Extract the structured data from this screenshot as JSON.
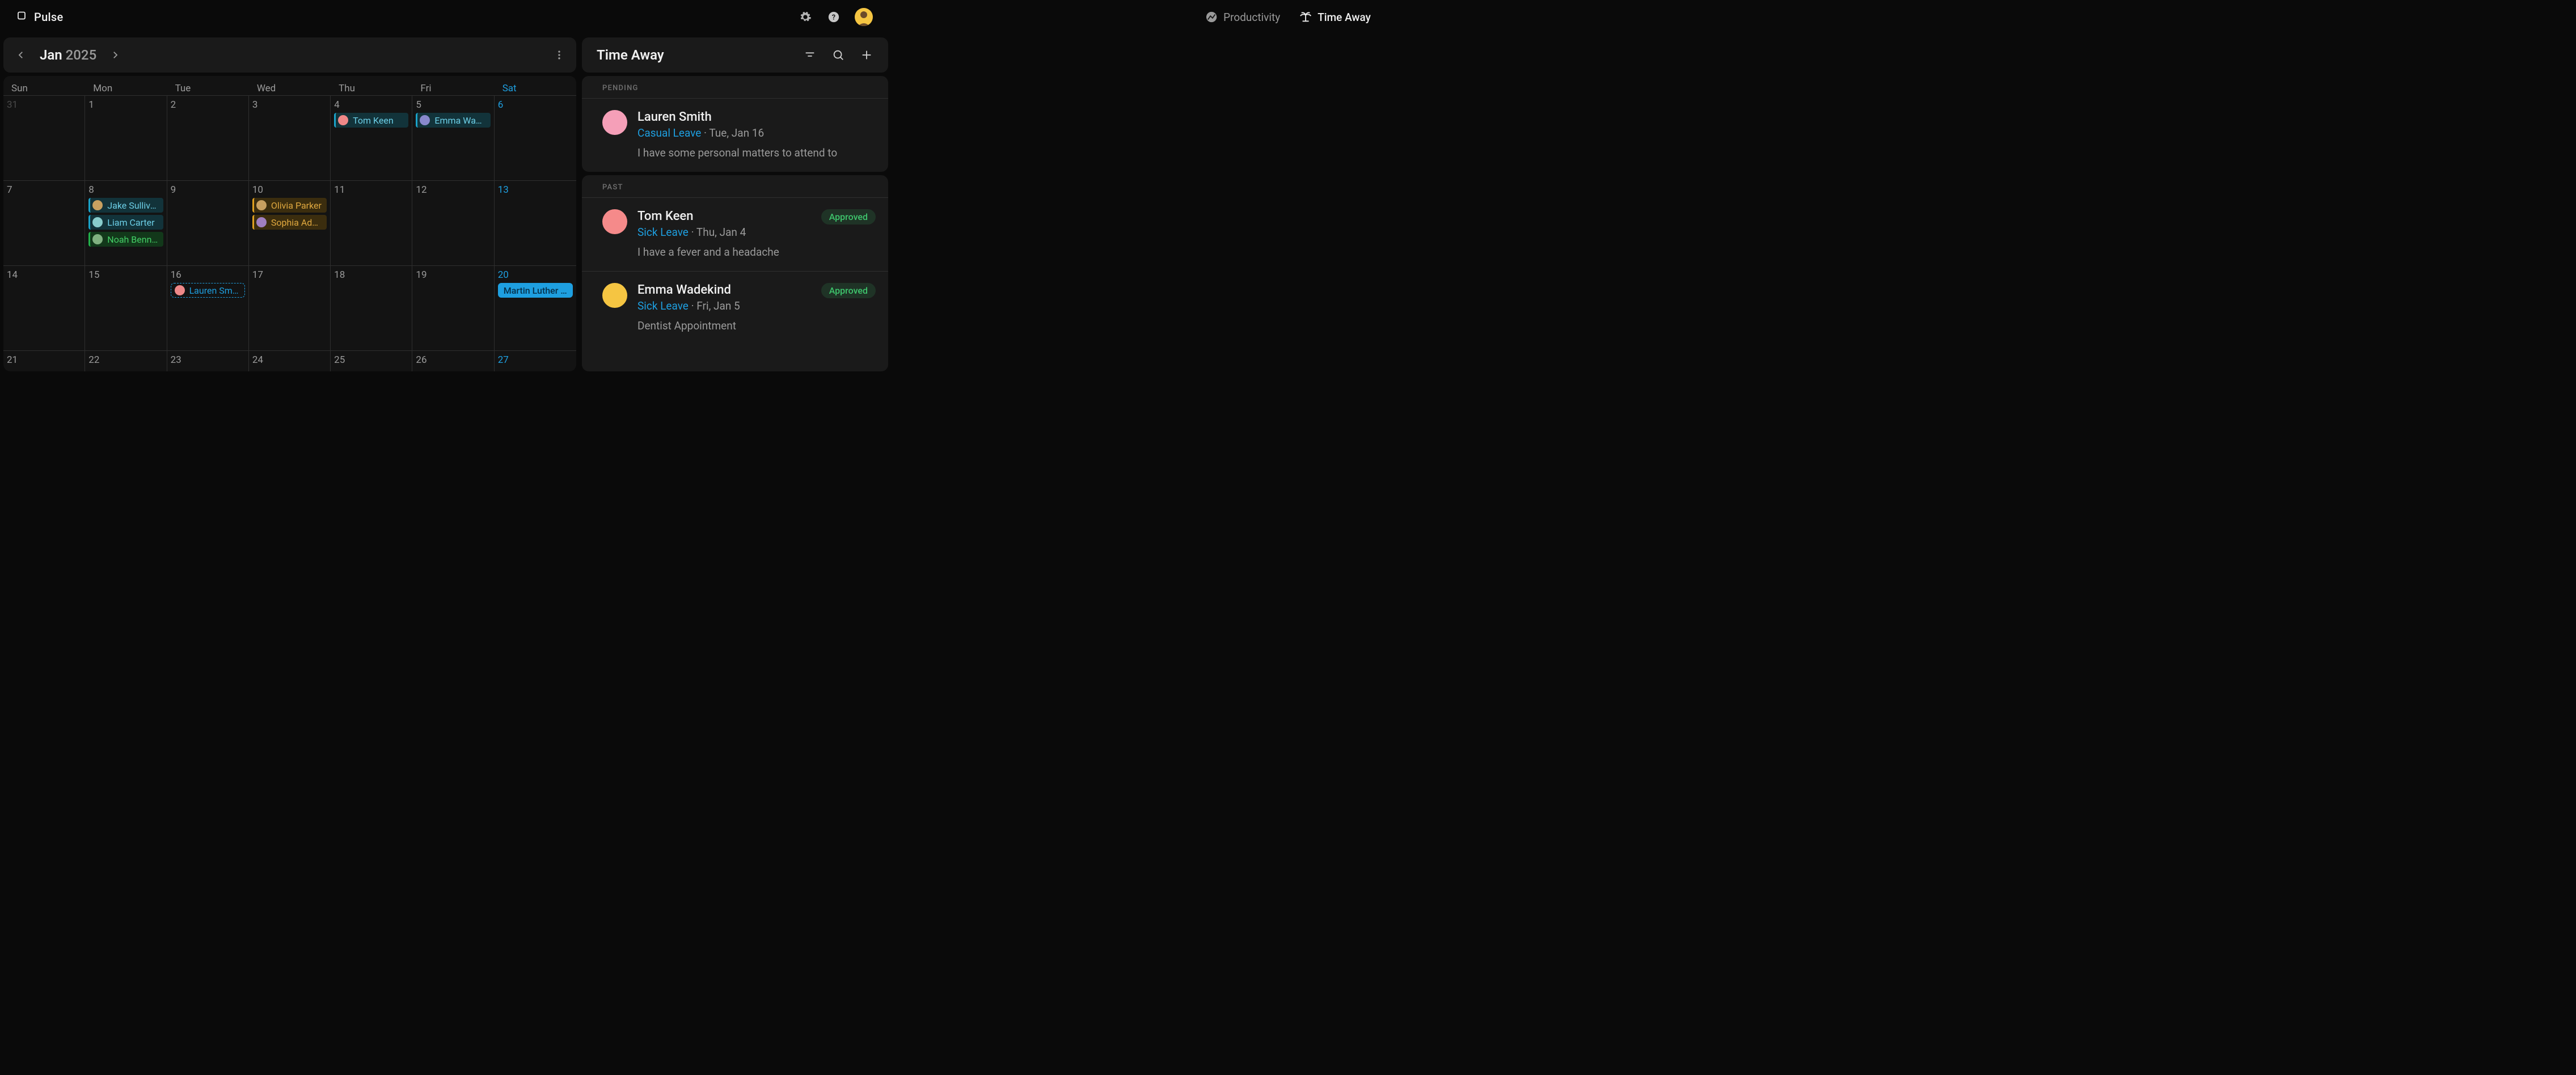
{
  "brand": {
    "name": "Pulse"
  },
  "tabs": {
    "productivity": "Productivity",
    "time_away": "Time Away"
  },
  "calendar": {
    "month": "Jan",
    "year": "2025",
    "day_labels": [
      "Sun",
      "Mon",
      "Tue",
      "Wed",
      "Thu",
      "Fri",
      "Sat"
    ],
    "weeks": [
      {
        "days": [
          {
            "num": "31",
            "off": true
          },
          {
            "num": "1"
          },
          {
            "num": "2"
          },
          {
            "num": "3"
          },
          {
            "num": "4",
            "events": [
              {
                "name": "Tom Keen",
                "style": "teal",
                "ava": "c1"
              }
            ]
          },
          {
            "num": "5",
            "events": [
              {
                "name": "Emma Wade…",
                "style": "teal",
                "ava": "c2"
              }
            ]
          },
          {
            "num": "6",
            "sat": true
          }
        ]
      },
      {
        "days": [
          {
            "num": "7"
          },
          {
            "num": "8",
            "events": [
              {
                "name": "Jake Sullivan",
                "style": "teal",
                "ava": "c3"
              },
              {
                "name": "Liam Carter",
                "style": "teal",
                "ava": "c4"
              },
              {
                "name": "Noah Bennett",
                "style": "green",
                "ava": "c6"
              }
            ]
          },
          {
            "num": "9"
          },
          {
            "num": "10",
            "events": [
              {
                "name": "Olivia Parker",
                "style": "amber",
                "ava": "c3"
              },
              {
                "name": "Sophia Adams",
                "style": "amber",
                "ava": "c5"
              }
            ]
          },
          {
            "num": "11"
          },
          {
            "num": "12"
          },
          {
            "num": "13",
            "sat": true
          }
        ]
      },
      {
        "days": [
          {
            "num": "14"
          },
          {
            "num": "15"
          },
          {
            "num": "16",
            "events": [
              {
                "name": "Lauren Smith",
                "style": "blue-dashed",
                "ava": "c1"
              }
            ]
          },
          {
            "num": "17"
          },
          {
            "num": "18"
          },
          {
            "num": "19"
          },
          {
            "num": "20",
            "sat": true,
            "events": [
              {
                "name": "Martin Luther Ki…",
                "style": "solid-blue"
              }
            ]
          }
        ]
      },
      {
        "days": [
          {
            "num": "21"
          },
          {
            "num": "22"
          },
          {
            "num": "23"
          },
          {
            "num": "24"
          },
          {
            "num": "25"
          },
          {
            "num": "26"
          },
          {
            "num": "27",
            "sat": true
          }
        ]
      }
    ]
  },
  "side": {
    "title": "Time Away",
    "pending_label": "PENDING",
    "past_label": "PAST",
    "pending": [
      {
        "name": "Lauren Smith",
        "kind": "Casual Leave",
        "sep": " · ",
        "date": "Tue, Jan 16",
        "note": "I have some personal matters to attend to",
        "ava": "pink"
      }
    ],
    "past": [
      {
        "name": "Tom Keen",
        "kind": "Sick Leave",
        "sep": " · ",
        "date": "Thu, Jan 4",
        "note": "I have a fever and a headache",
        "badge": "Approved",
        "ava": "coral"
      },
      {
        "name": "Emma Wadekind",
        "kind": "Sick Leave",
        "sep": " · ",
        "date": "Fri, Jan 5",
        "note": "Dentist Appointment",
        "badge": "Approved",
        "ava": "gold"
      }
    ]
  }
}
